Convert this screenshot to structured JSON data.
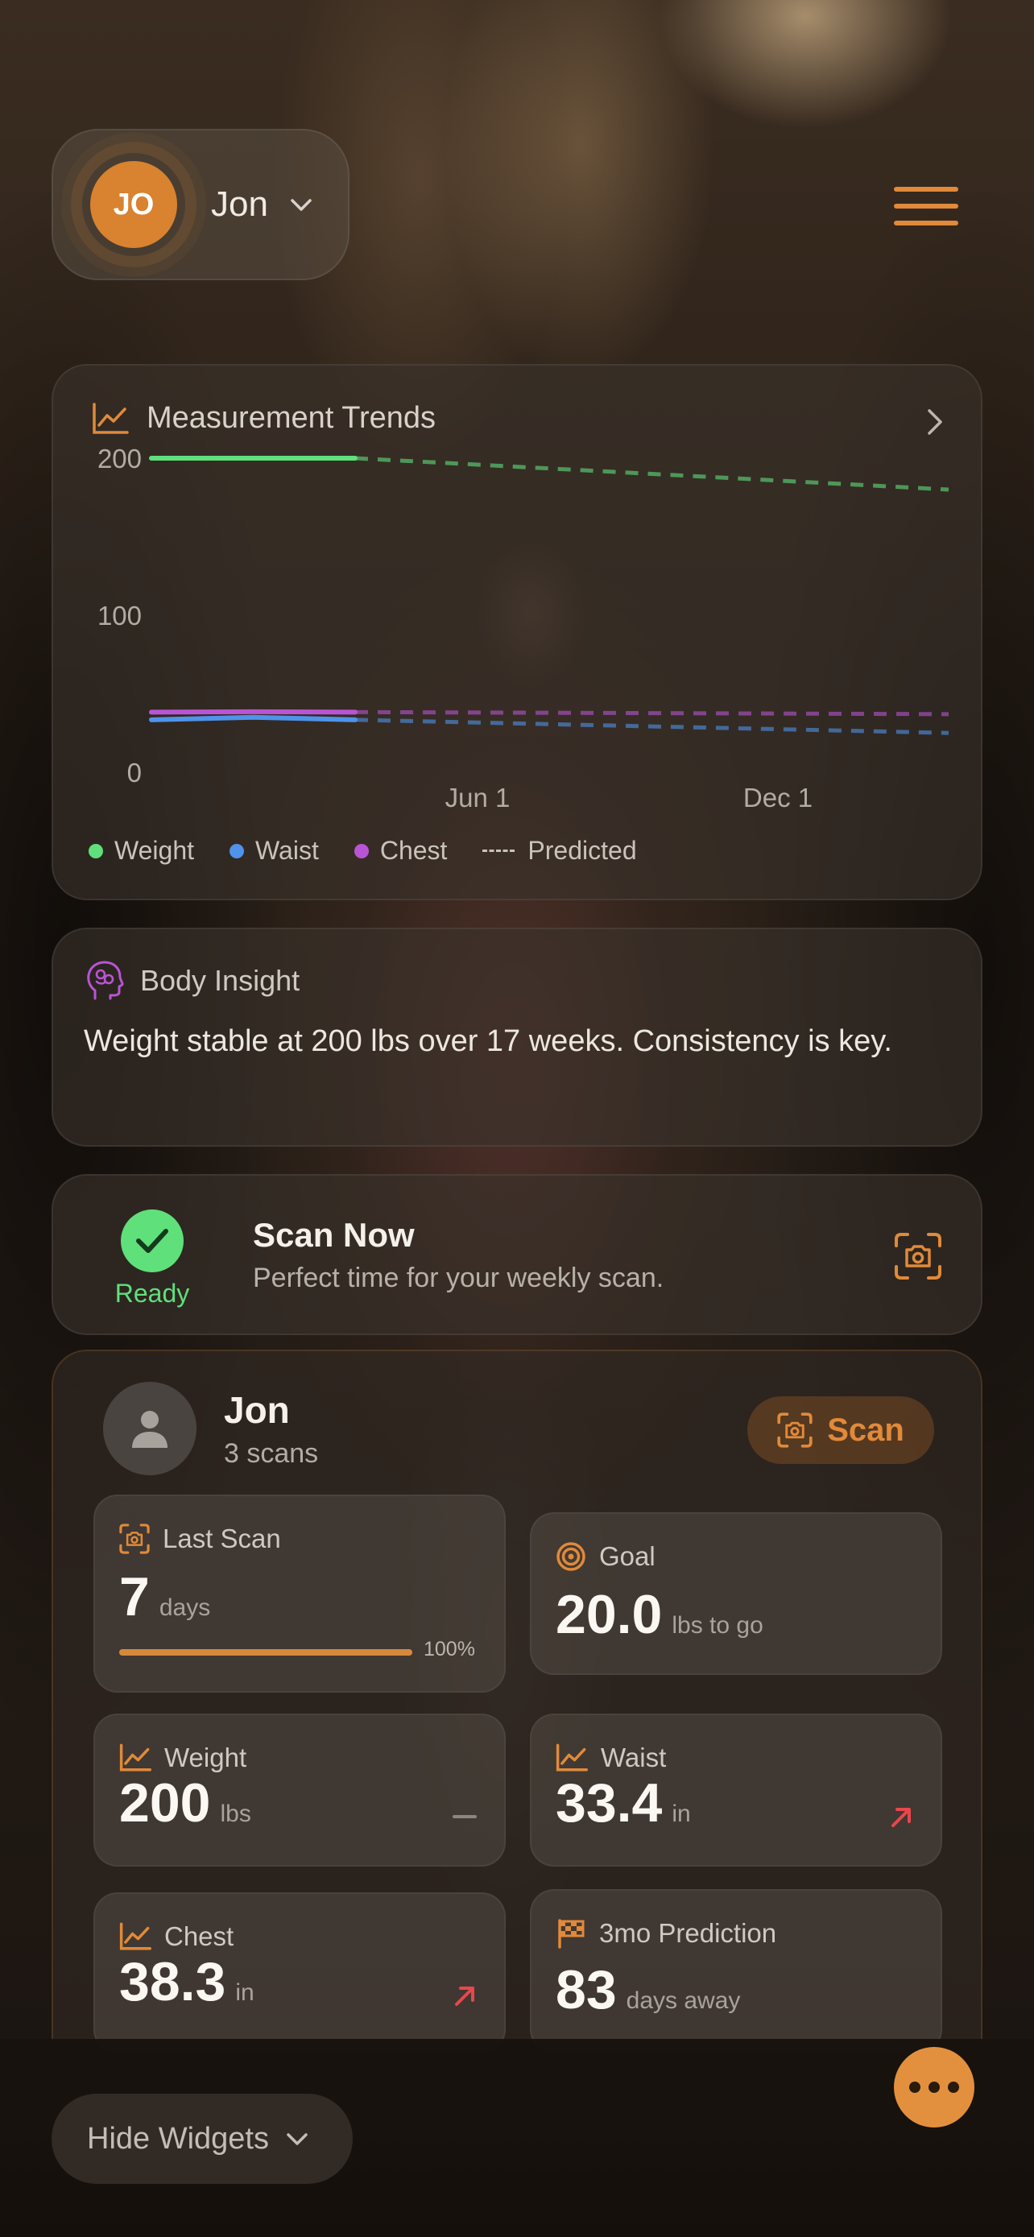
{
  "header": {
    "avatar_initials": "JO",
    "user_name": "Jon",
    "menu_icon": "hamburger-menu-icon"
  },
  "trends": {
    "title": "Measurement Trends",
    "legend": [
      {
        "label": "Weight",
        "color": "#5fe07b"
      },
      {
        "label": "Waist",
        "color": "#4f93ea"
      },
      {
        "label": "Chest",
        "color": "#b855d4"
      },
      {
        "label": "Predicted",
        "style": "dashed"
      }
    ]
  },
  "chart_data": {
    "type": "line",
    "title": "Measurement Trends",
    "y_ticks": [
      "200",
      "100",
      "0"
    ],
    "x_ticks": [
      "Jun 1",
      "Dec 1"
    ],
    "ylim": [
      0,
      200
    ],
    "grid": false,
    "legend_position": "bottom-left",
    "series": [
      {
        "name": "Weight",
        "color": "#5fe07b",
        "actual": [
          200,
          200
        ],
        "predicted": [
          200,
          180
        ]
      },
      {
        "name": "Waist",
        "color": "#4f93ea",
        "actual": [
          33.4,
          35,
          33.4
        ],
        "predicted": [
          33.4,
          25
        ]
      },
      {
        "name": "Chest",
        "color": "#b855d4",
        "actual": [
          38.3,
          38.5,
          38.3
        ],
        "predicted": [
          38.3,
          37
        ]
      }
    ]
  },
  "insight": {
    "label": "Body Insight",
    "text": "Weight stable at 200 lbs over 17 weeks. Consistency is key."
  },
  "scan_now": {
    "status": "Ready",
    "title": "Scan Now",
    "subtitle": "Perfect time for your weekly scan."
  },
  "profile": {
    "name": "Jon",
    "scans": "3 scans",
    "scan_button": "Scan"
  },
  "tiles": {
    "last_scan": {
      "label": "Last Scan",
      "value": "7",
      "unit": "days",
      "progress_pct": "100%",
      "progress": 1.0
    },
    "goal": {
      "label": "Goal",
      "value": "20.0",
      "unit": "lbs to go"
    },
    "weight": {
      "label": "Weight",
      "value": "200",
      "unit": "lbs",
      "trend": "flat"
    },
    "waist": {
      "label": "Waist",
      "value": "33.4",
      "unit": "in",
      "trend": "up"
    },
    "chest": {
      "label": "Chest",
      "value": "38.3",
      "unit": "in",
      "trend": "up"
    },
    "prediction": {
      "label": "3mo Prediction",
      "value": "83",
      "unit": "days away"
    }
  },
  "footer": {
    "hide_widgets": "Hide Widgets"
  },
  "colors": {
    "accent": "#e08a3a",
    "ready": "#5fe07b",
    "trend_up": "#e8474c"
  }
}
